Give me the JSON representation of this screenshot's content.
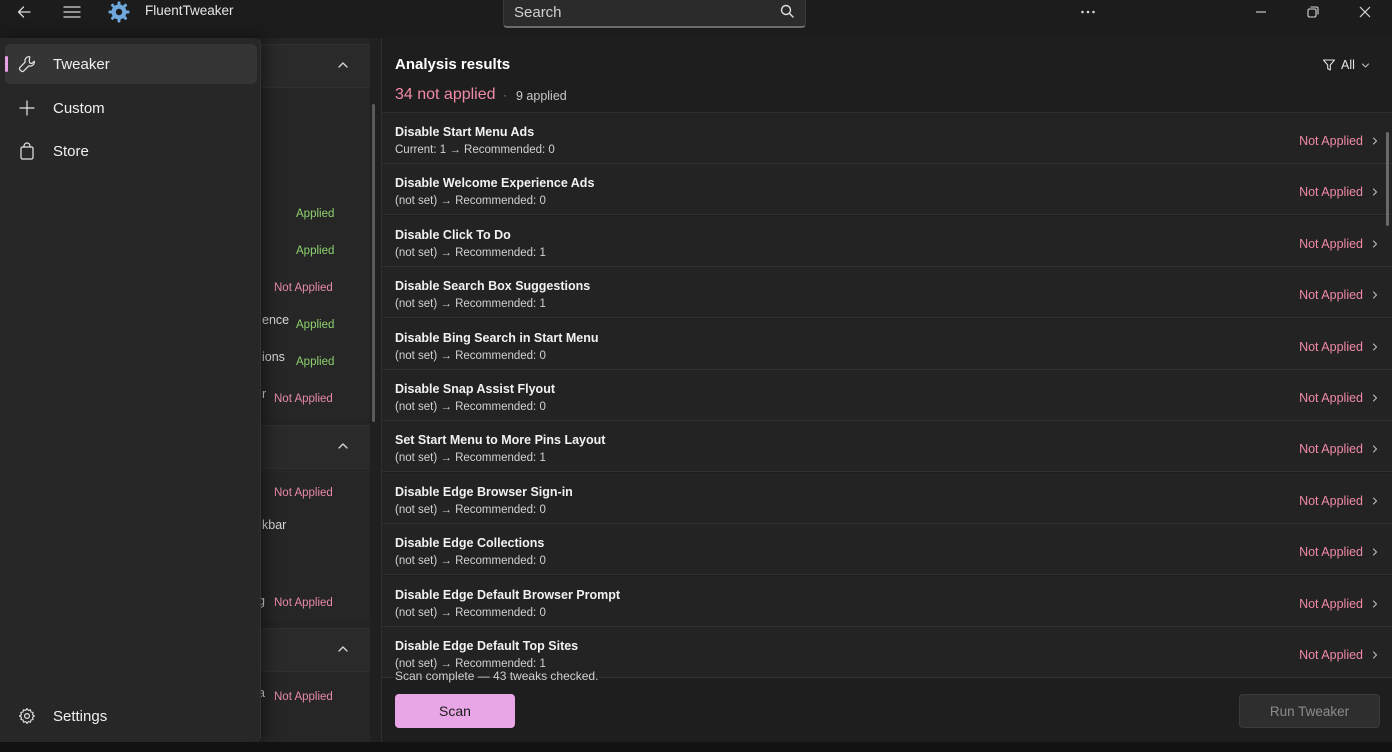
{
  "app": {
    "title": "FluentTweaker"
  },
  "search": {
    "placeholder": "Search"
  },
  "nav": {
    "items": [
      {
        "label": "Tweaker",
        "icon": "wrench-icon",
        "selected": true
      },
      {
        "label": "Custom",
        "icon": "plus-icon",
        "selected": false
      },
      {
        "label": "Store",
        "icon": "shopping-bag-icon",
        "selected": false
      }
    ],
    "settings": {
      "label": "Settings",
      "icon": "gear-icon"
    }
  },
  "background_column": {
    "statuses": [
      {
        "text": "Applied",
        "state": "applied"
      },
      {
        "text": "Applied",
        "state": "applied"
      },
      {
        "text": "Not Applied",
        "state": "not_applied"
      },
      {
        "text": "Applied",
        "state": "applied"
      },
      {
        "text": "Applied",
        "state": "applied"
      },
      {
        "text": "Not Applied",
        "state": "not_applied"
      },
      {
        "text": "Not Applied",
        "state": "not_applied"
      },
      {
        "text": "Not Applied",
        "state": "not_applied"
      },
      {
        "text": "Not Applied",
        "state": "not_applied"
      }
    ],
    "partial_labels": [
      "ence",
      "ions",
      "r",
      "kbar",
      "g",
      "a"
    ]
  },
  "results": {
    "title": "Analysis results",
    "not_applied_summary": "34 not applied",
    "separator": "·",
    "applied_summary": "9 applied",
    "filter_label": "All",
    "rows": [
      {
        "name": "Disable Start Menu Ads",
        "detail": "Current: 1  →  Recommended: 0",
        "status": "Not Applied"
      },
      {
        "name": "Disable Welcome Experience Ads",
        "detail": "(not set)  →  Recommended: 0",
        "status": "Not Applied"
      },
      {
        "name": "Disable Click To Do",
        "detail": "(not set)  →  Recommended: 1",
        "status": "Not Applied"
      },
      {
        "name": "Disable Search Box Suggestions",
        "detail": "(not set)  →  Recommended: 1",
        "status": "Not Applied"
      },
      {
        "name": "Disable Bing Search in Start Menu",
        "detail": "(not set)  →  Recommended: 0",
        "status": "Not Applied"
      },
      {
        "name": "Disable Snap Assist Flyout",
        "detail": "(not set)  →  Recommended: 0",
        "status": "Not Applied"
      },
      {
        "name": "Set Start Menu to More Pins Layout",
        "detail": "(not set)  →  Recommended: 1",
        "status": "Not Applied"
      },
      {
        "name": "Disable Edge Browser Sign-in",
        "detail": "(not set)  →  Recommended: 0",
        "status": "Not Applied"
      },
      {
        "name": "Disable Edge Collections",
        "detail": "(not set)  →  Recommended: 0",
        "status": "Not Applied"
      },
      {
        "name": "Disable Edge Default Browser Prompt",
        "detail": "(not set)  →  Recommended: 0",
        "status": "Not Applied"
      },
      {
        "name": "Disable Edge Default Top Sites",
        "detail": "(not set)  →  Recommended: 1",
        "status": "Not Applied"
      }
    ],
    "scan_status": "Scan complete — 43 tweaks checked."
  },
  "actions": {
    "scan_label": "Scan",
    "run_label": "Run Tweaker"
  },
  "colors": {
    "accent": "#e9a6e6",
    "not_applied": "#f08aa5",
    "applied": "#8ed16f",
    "background": "#202020"
  }
}
